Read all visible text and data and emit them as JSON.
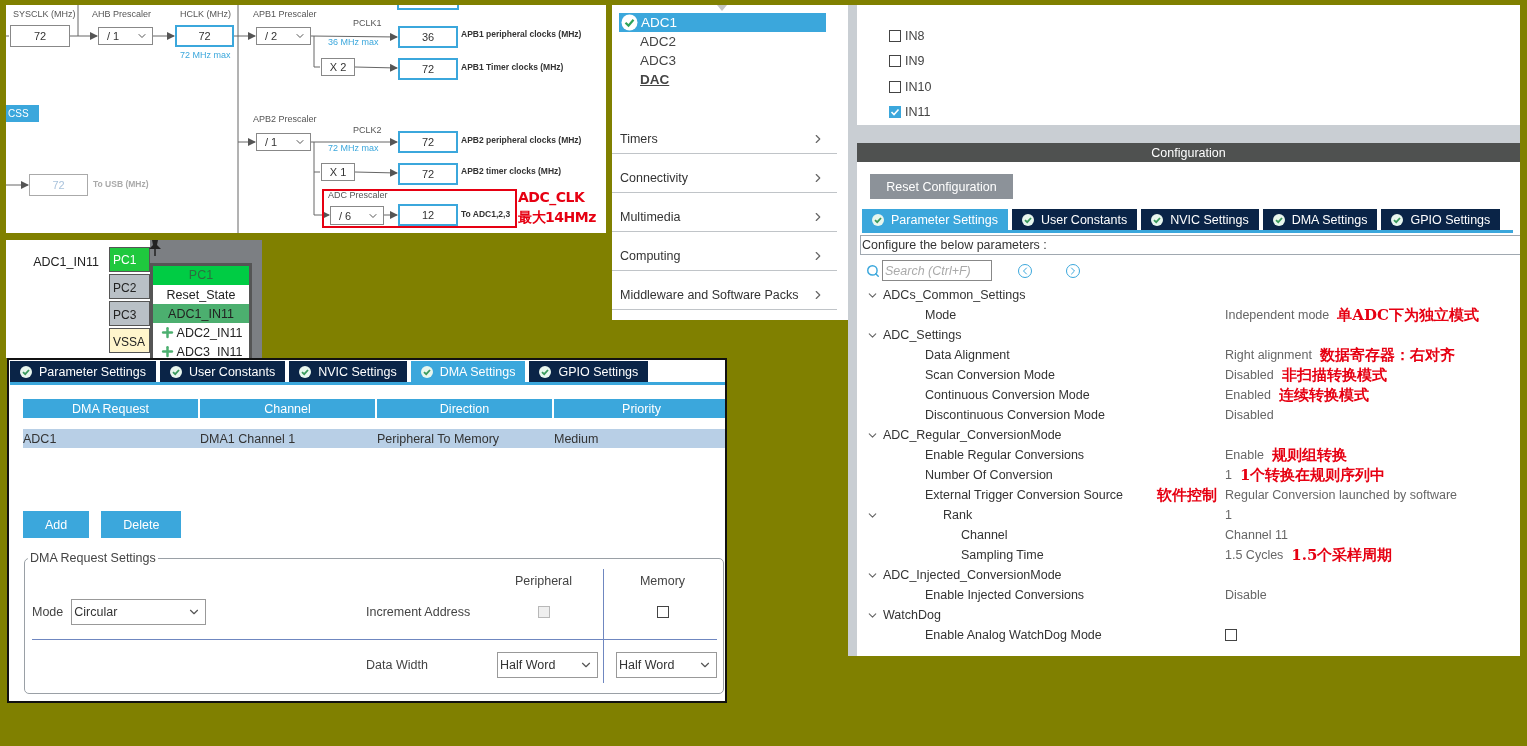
{
  "clock_tree": {
    "items": [
      {
        "kind": "label",
        "text": "SYSCLK (MHz)"
      },
      {
        "kind": "value",
        "text": "72"
      },
      {
        "kind": "label",
        "text": "AHB Prescaler"
      },
      {
        "kind": "select",
        "text": "/ 1"
      },
      {
        "kind": "label",
        "text": "HCLK (MHz)"
      },
      {
        "kind": "output",
        "text": "72"
      },
      {
        "kind": "note",
        "text": "72 MHz max"
      },
      {
        "kind": "label",
        "text": "APB1 Prescaler"
      },
      {
        "kind": "select",
        "text": "/ 2"
      },
      {
        "kind": "label",
        "text": "PCLK1"
      },
      {
        "kind": "note",
        "text": "36 MHz max"
      },
      {
        "kind": "output",
        "text": "36"
      },
      {
        "kind": "caption",
        "text": "APB1 peripheral clocks (MHz)"
      },
      {
        "kind": "value",
        "text": "X 2"
      },
      {
        "kind": "output",
        "text": "72"
      },
      {
        "kind": "caption",
        "text": "APB1 Timer clocks (MHz)"
      },
      {
        "kind": "button",
        "text": "CSS"
      },
      {
        "kind": "label",
        "text": "APB2 Prescaler"
      },
      {
        "kind": "select",
        "text": "/ 1"
      },
      {
        "kind": "label",
        "text": "PCLK2"
      },
      {
        "kind": "note",
        "text": "72 MHz max"
      },
      {
        "kind": "output",
        "text": "72"
      },
      {
        "kind": "caption",
        "text": "APB2 peripheral clocks (MHz)"
      },
      {
        "kind": "value",
        "text": "X 1"
      },
      {
        "kind": "output",
        "text": "72"
      },
      {
        "kind": "caption",
        "text": "APB2 timer clocks (MHz)"
      },
      {
        "kind": "label",
        "text": "ADC Prescaler"
      },
      {
        "kind": "select",
        "text": "/ 6"
      },
      {
        "kind": "output",
        "text": "12"
      },
      {
        "kind": "caption",
        "text": "To ADC1,2,3"
      },
      {
        "kind": "annotation",
        "text": "ADC_CLK"
      },
      {
        "kind": "annotation",
        "text": "最大14HMz"
      },
      {
        "kind": "disabled_output",
        "text": "72"
      },
      {
        "kind": "disabled_label",
        "text": "To USB (MHz)"
      }
    ]
  },
  "pinout": {
    "signal_label": "ADC1_IN11",
    "pins": [
      {
        "name": "PC1",
        "kind": "assigned"
      },
      {
        "name": "PC2",
        "kind": "io"
      },
      {
        "name": "PC3",
        "kind": "io"
      },
      {
        "name": "VSSA",
        "kind": "power"
      }
    ],
    "menu": {
      "title": "PC1",
      "items": [
        {
          "label": "Reset_State",
          "kind": "reset",
          "selected": false
        },
        {
          "label": "ADC1_IN11",
          "kind": "signal",
          "selected": true
        },
        {
          "label": "ADC2_IN11",
          "kind": "signal",
          "selected": false
        },
        {
          "label": "ADC3_IN11",
          "kind": "signal",
          "selected": false
        }
      ]
    }
  },
  "dma_panel": {
    "tabs": [
      {
        "label": "Parameter Settings",
        "selected": false
      },
      {
        "label": "User Constants",
        "selected": false
      },
      {
        "label": "NVIC Settings",
        "selected": false
      },
      {
        "label": "DMA Settings",
        "selected": true
      },
      {
        "label": "GPIO Settings",
        "selected": false
      }
    ],
    "table": {
      "columns": [
        "DMA Request",
        "Channel",
        "Direction",
        "Priority"
      ],
      "rows": [
        {
          "cells": [
            "ADC1",
            "DMA1 Channel 1",
            "Peripheral To Memory",
            "Medium"
          ],
          "selected": true
        }
      ]
    },
    "buttons": [
      "Add",
      "Delete"
    ],
    "request_settings": {
      "title": "DMA Request Settings",
      "mode_label": "Mode",
      "mode": "Circular",
      "peripheral_header": "Peripheral",
      "memory_header": "Memory",
      "increment_label": "Increment Address",
      "peripheral_increment": {
        "checked": false,
        "disabled": true
      },
      "memory_increment": {
        "checked": false,
        "disabled": false
      },
      "data_width_label": "Data Width",
      "peripheral_width": "Half Word",
      "memory_width": "Half Word"
    }
  },
  "peripheral_list": {
    "items": [
      {
        "label": "ADC1",
        "selected": true,
        "configured": true,
        "hovered": false
      },
      {
        "label": "ADC2",
        "selected": false,
        "configured": false,
        "hovered": false
      },
      {
        "label": "ADC3",
        "selected": false,
        "configured": false,
        "hovered": false
      },
      {
        "label": "DAC",
        "selected": false,
        "configured": false,
        "hovered": true
      }
    ],
    "categories": [
      "Timers",
      "Connectivity",
      "Multimedia",
      "Computing",
      "Middleware and Software Packs"
    ]
  },
  "adc_config": {
    "channels": [
      {
        "label": "IN8",
        "checked": false
      },
      {
        "label": "IN9",
        "checked": false
      },
      {
        "label": "IN10",
        "checked": false
      },
      {
        "label": "IN11",
        "checked": true
      }
    ],
    "section_title": "Configuration",
    "reset_button": "Reset Configuration",
    "tabs": [
      {
        "label": "Parameter Settings",
        "selected": true
      },
      {
        "label": "User Constants",
        "selected": false
      },
      {
        "label": "NVIC Settings",
        "selected": false
      },
      {
        "label": "DMA Settings",
        "selected": false
      },
      {
        "label": "GPIO Settings",
        "selected": false
      }
    ],
    "hint": "Configure the below parameters :",
    "search": {
      "placeholder": "Search (Ctrl+F)"
    },
    "tree": [
      {
        "label": "ADCs_Common_Settings",
        "expanded": true,
        "children": [
          {
            "label": "Mode",
            "kind": "value",
            "value": "Independent mode",
            "note": "单ADC下为独立模式"
          }
        ]
      },
      {
        "label": "ADC_Settings",
        "expanded": true,
        "children": [
          {
            "label": "Data Alignment",
            "kind": "value",
            "value": "Right alignment",
            "note": "数据寄存器：右对齐"
          },
          {
            "label": "Scan Conversion Mode",
            "kind": "value",
            "value": "Disabled",
            "note": "非扫描转换模式"
          },
          {
            "label": "Continuous Conversion Mode",
            "kind": "value",
            "value": "Enabled",
            "note": "连续转换模式"
          },
          {
            "label": "Discontinuous Conversion Mode",
            "kind": "value",
            "value": "Disabled"
          }
        ]
      },
      {
        "label": "ADC_Regular_ConversionMode",
        "expanded": true,
        "children": [
          {
            "label": "Enable Regular Conversions",
            "kind": "value",
            "value": "Enable",
            "note": "规则组转换"
          },
          {
            "label": "Number Of Conversion",
            "kind": "value",
            "value": "1",
            "note": "1个转换在规则序列中"
          },
          {
            "label": "External Trigger Conversion Source",
            "kind": "value",
            "value": "Regular Conversion launched by software",
            "note_before": "软件控制"
          },
          {
            "label": "Rank",
            "kind": "value",
            "value": "1",
            "expanded": true,
            "children": [
              {
                "label": "Channel",
                "kind": "value",
                "value": "Channel 11"
              },
              {
                "label": "Sampling Time",
                "kind": "value",
                "value": "1.5 Cycles",
                "note": "1.5个采样周期"
              }
            ]
          }
        ]
      },
      {
        "label": "ADC_Injected_ConversionMode",
        "expanded": true,
        "children": [
          {
            "label": "Enable Injected Conversions",
            "kind": "value",
            "value": "Disable"
          }
        ]
      },
      {
        "label": "WatchDog",
        "expanded": true,
        "children": [
          {
            "label": "Enable Analog WatchDog Mode",
            "kind": "checkbox",
            "checked": false
          }
        ]
      }
    ]
  }
}
